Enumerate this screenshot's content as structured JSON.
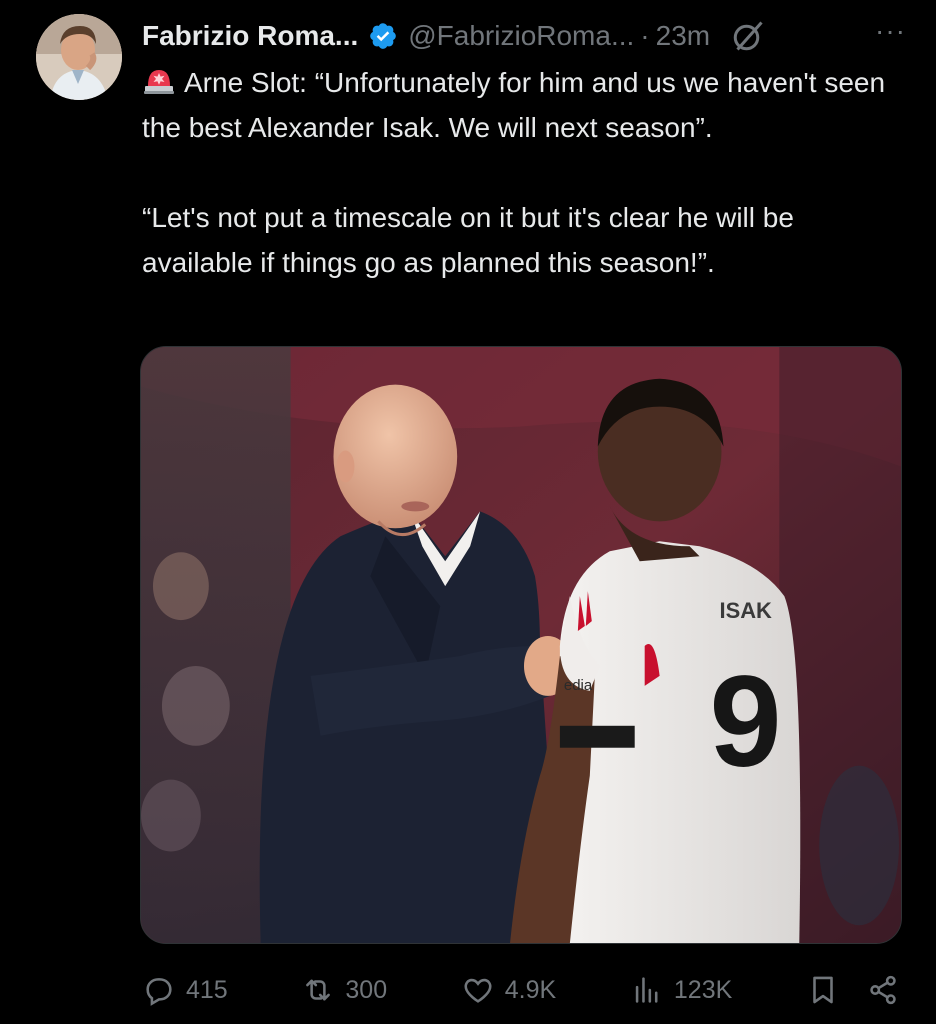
{
  "author": {
    "name": "Fabrizio Roma...",
    "handle": "@FabrizioRoma...",
    "separator": "·",
    "time": "23m",
    "more": "···"
  },
  "icons": {
    "verified": "verified-badge-icon",
    "grok": "grok-icon",
    "siren": "siren-emoji-icon"
  },
  "tweet": {
    "paragraph1": "Arne Slot: “Unfortunately for him and us we haven't seen the best Alexander Isak. We will next season”.",
    "paragraph2": "“Let's not put a timescale on it but it's clear he will be available if things go as planned this season!”."
  },
  "media": {
    "shirt_name": "ISAK",
    "shirt_number": "9",
    "sponsor": "edia"
  },
  "actions": {
    "replies": "415",
    "reposts": "300",
    "likes": "4.9K",
    "views": "123K"
  },
  "colors": {
    "background": "#000000",
    "text": "#e7e9ea",
    "muted": "#71767b",
    "verified": "#1d9bf0"
  }
}
